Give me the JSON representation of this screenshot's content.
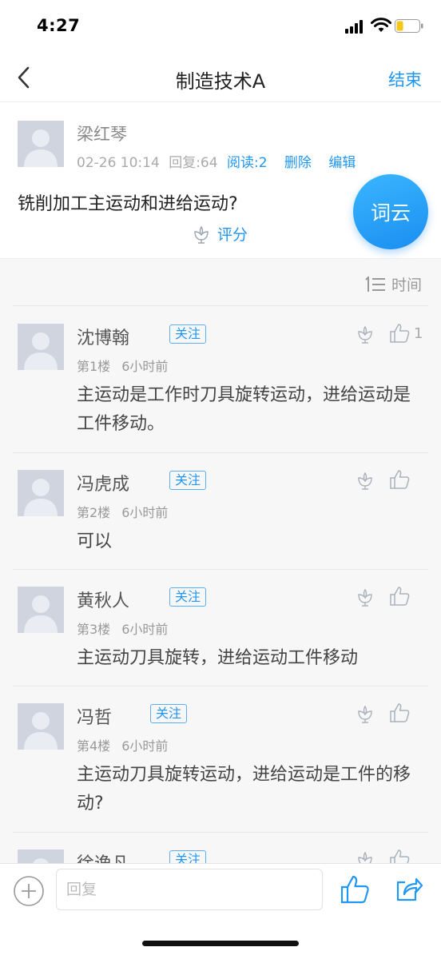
{
  "status_bar": {
    "time": "4:27"
  },
  "nav": {
    "title": "制造技术A",
    "end_label": "结束"
  },
  "post": {
    "author": "梁红琴",
    "date": "02-26 10:14",
    "reply_count": "回复:64",
    "read_count": "阅读:2",
    "delete_label": "删除",
    "edit_label": "编辑",
    "question": "铣削加工主运动和进给运动?",
    "rate_label": "评分",
    "ciyun_label": "词云"
  },
  "sort": {
    "label": "时间"
  },
  "replies": [
    {
      "name": "沈博翰",
      "follow": "关注",
      "floor": "第1楼",
      "time": "6小时前",
      "text": "主运动是工作时刀具旋转运动，进给运动是工件移动。",
      "likes": "1"
    },
    {
      "name": "冯虎成",
      "follow": "关注",
      "floor": "第2楼",
      "time": "6小时前",
      "text": "可以",
      "likes": ""
    },
    {
      "name": "黄秋人",
      "follow": "关注",
      "floor": "第3楼",
      "time": "6小时前",
      "text": "主运动刀具旋转，进给运动工件移动",
      "likes": ""
    },
    {
      "name": "冯哲",
      "follow": "关注",
      "floor": "第4楼",
      "time": "6小时前",
      "text": "主运动刀具旋转运动，进给运动是工件的移动?",
      "likes": ""
    },
    {
      "name": "徐逸凡",
      "follow": "关注",
      "floor": "",
      "time": "",
      "text": "",
      "likes": ""
    }
  ],
  "bottom_bar": {
    "reply_placeholder": "回复"
  },
  "colors": {
    "accent": "#2196f3",
    "avatar_bg": "#cfd4df",
    "list_bg": "#f7f7f7"
  },
  "icons": [
    "back-chevron-icon",
    "flower-icon",
    "thumbs-up-icon",
    "sort-list-icon",
    "plus-circle-icon",
    "share-icon"
  ]
}
